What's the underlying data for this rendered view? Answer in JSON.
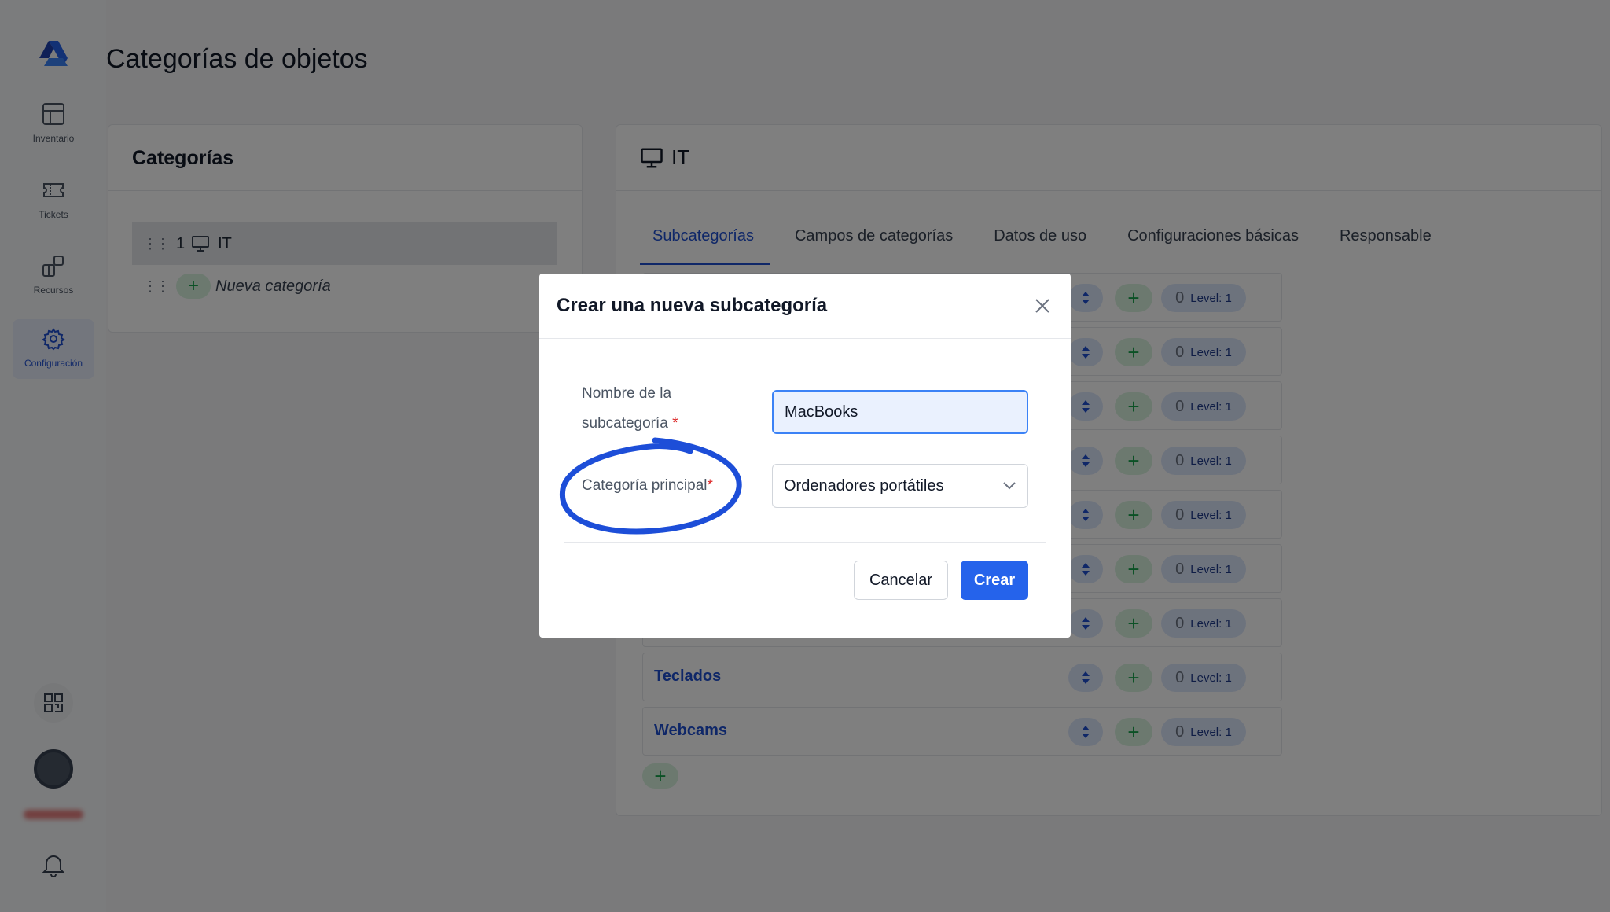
{
  "page": {
    "title": "Categorías de objetos"
  },
  "colors": {
    "accent": "#1f4fd1",
    "primary_button": "#2563eb",
    "add_green": "#16a34a",
    "required": "#dc2626",
    "annotation": "#1d4ed8"
  },
  "sidebar": {
    "logo_icon": "logo-icon",
    "items": [
      {
        "label": "Inventario",
        "icon": "table-icon"
      },
      {
        "label": "Tickets",
        "icon": "ticket-icon"
      },
      {
        "label": "Recursos",
        "icon": "resources-icon"
      },
      {
        "label": "Configuración",
        "icon": "gear-icon",
        "active": true
      }
    ],
    "bottom": {
      "qr_icon": "qr-code-icon",
      "bell_icon": "bell-icon"
    }
  },
  "categories_panel": {
    "title": "Categorías",
    "rows": [
      {
        "count": "1",
        "icon": "monitor-icon",
        "label": "IT"
      }
    ],
    "new_label": "Nueva categoría"
  },
  "detail_panel": {
    "icon": "monitor-icon",
    "title": "IT",
    "tabs": [
      "Subcategorías",
      "Campos de categorías",
      "Datos de uso",
      "Configuraciones básicas",
      "Responsable"
    ],
    "active_tab": "Subcategorías",
    "subcategories": [
      {
        "name": "",
        "count": "0",
        "level": "Level: 1"
      },
      {
        "name": "",
        "count": "0",
        "level": "Level: 1"
      },
      {
        "name": "",
        "count": "0",
        "level": "Level: 1"
      },
      {
        "name": "",
        "count": "0",
        "level": "Level: 1"
      },
      {
        "name": "",
        "count": "0",
        "level": "Level: 1"
      },
      {
        "name": "",
        "count": "0",
        "level": "Level: 1"
      },
      {
        "name": "",
        "count": "0",
        "level": "Level: 1"
      },
      {
        "name": "Teclados",
        "count": "0",
        "level": "Level: 1"
      },
      {
        "name": "Webcams",
        "count": "0",
        "level": "Level: 1"
      }
    ]
  },
  "modal": {
    "title": "Crear una nueva subcategoría",
    "name_label_line1": "Nombre de la",
    "name_label_line2": "subcategoría",
    "name_value": "MacBooks",
    "parent_label": "Categoría principal",
    "required_mark": "*",
    "parent_value": "Ordenadores portátiles",
    "cancel_label": "Cancelar",
    "create_label": "Crear"
  }
}
